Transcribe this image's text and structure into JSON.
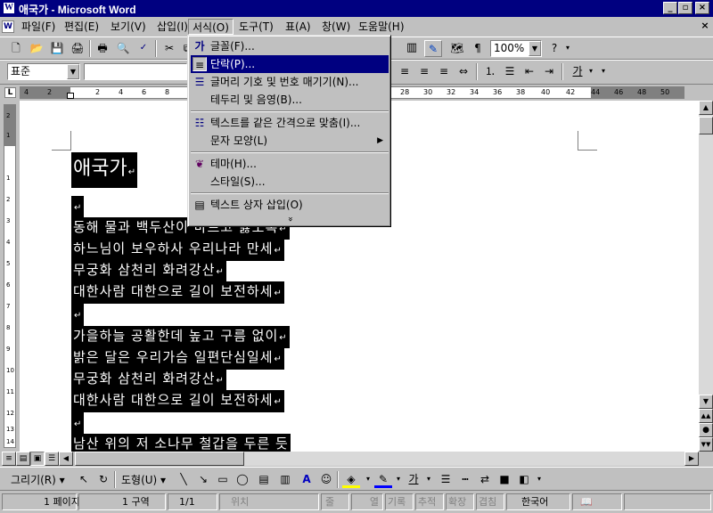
{
  "window": {
    "title": "애국가 - Microsoft Word",
    "app_icon": "word-icon"
  },
  "menubar": [
    "파일(F)",
    "편집(E)",
    "보기(V)",
    "삽입(I)",
    "서식(O)",
    "도구(T)",
    "표(A)",
    "창(W)",
    "도움말(H)"
  ],
  "toolbar": {
    "zoom": "100%",
    "style": "표준"
  },
  "format_menu": {
    "items": [
      {
        "label": "글꼴(F)...",
        "icon": "font-icon"
      },
      {
        "label": "단락(P)...",
        "icon": "paragraph-icon",
        "selected": true
      },
      {
        "label": "글머리 기호 및 번호 매기기(N)...",
        "icon": "bullets-icon"
      },
      {
        "label": "테두리 및 음영(B)...",
        "icon": ""
      },
      {
        "label": "텍스트를 같은 간격으로 맞춤(I)...",
        "icon": "distribute-icon"
      },
      {
        "label": "문자 모양(L)",
        "icon": "",
        "submenu": true
      },
      {
        "label": "테마(H)...",
        "icon": "theme-icon"
      },
      {
        "label": "스타일(S)...",
        "icon": ""
      },
      {
        "label": "텍스트 상자 삽입(O)",
        "icon": "textbox-icon"
      }
    ],
    "more_glyph": "»"
  },
  "ruler": {
    "h_numbers": [
      "4",
      "2",
      "2",
      "4",
      "6",
      "8",
      "28",
      "30",
      "32",
      "34",
      "36",
      "38",
      "40",
      "42",
      "44",
      "46",
      "48",
      "50"
    ],
    "v_numbers": [
      "2",
      "1",
      "1",
      "2",
      "3",
      "4",
      "5",
      "6",
      "7",
      "8",
      "9",
      "10",
      "11",
      "12",
      "13",
      "14"
    ]
  },
  "document": {
    "title": "애국가",
    "pilcrow": "↵",
    "lines": [
      "",
      "동해 물과 백두산이 마르고 닳도록",
      "하느님이 보우하사 우리나라 만세",
      "무궁화 삼천리 화려강산",
      "대한사람 대한으로 길이 보전하세",
      "",
      "가을하늘 공활한데 높고 구름 없이",
      "밝은 달은 우리가슴 일편단심일세",
      "무궁화 삼천리 화려강산",
      "대한사람 대한으로 길이 보전하세",
      "",
      "남산 위의 저 소나무 철갑을 두른 듯"
    ]
  },
  "drawing_toolbar": {
    "draw": "그리기(R)",
    "shapes": "도형(U)"
  },
  "status": {
    "page": "1 페이지",
    "section": "1 구역",
    "pages": "1/1",
    "at": "위치",
    "line": "줄",
    "col": "열",
    "rec": "기록",
    "trk": "추적",
    "ext": "확장",
    "ovr": "겹침",
    "language": "한국어"
  }
}
